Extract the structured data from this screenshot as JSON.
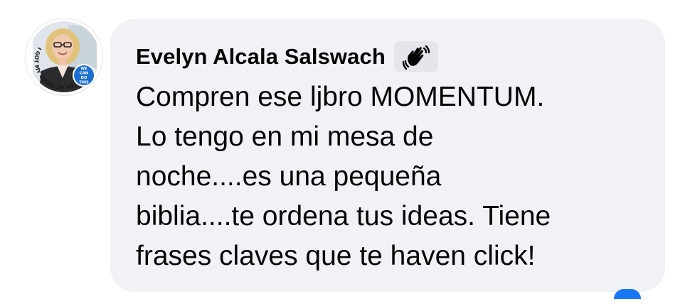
{
  "comment": {
    "author": "Evelyn Alcala Salswach",
    "badge_icon": "waving-hand-icon",
    "text": "Compren ese ljbro MOMENTUM.\nLo tengo en mi mesa de\nnoche....es una pequeña\nbiblia....te ordena tus ideas. Tiene\nfrases claves que te haven click!"
  },
  "avatar": {
    "frame_text": "I GOT MY COVID-19 VACCINE",
    "badge_text": [
      "WE",
      "CAN",
      "DO",
      "THIS"
    ],
    "badge_color": "#1b6fcf"
  },
  "colors": {
    "bubble": "#f0f2f5",
    "text": "#050505",
    "accent": "#1877f2"
  }
}
